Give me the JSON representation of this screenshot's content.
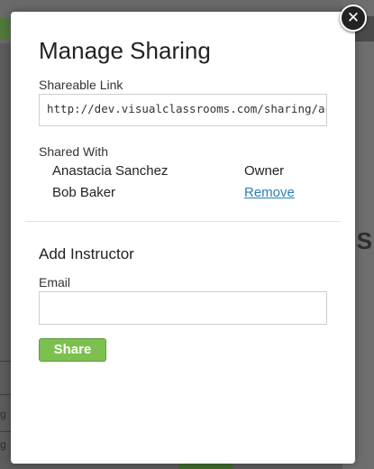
{
  "modal": {
    "title": "Manage Sharing",
    "close_icon": "close-icon",
    "shareable_link": {
      "label": "Shareable Link",
      "value": "http://dev.visualclassrooms.com/sharing/ac"
    },
    "shared_with": {
      "label": "Shared With",
      "people": [
        {
          "name": "Anastacia Sanchez",
          "role": "Owner"
        },
        {
          "name": "Bob Baker",
          "action": "Remove"
        }
      ]
    },
    "add_instructor": {
      "title": "Add Instructor",
      "email_label": "Email",
      "email_value": "",
      "share_button": "Share"
    }
  },
  "background": {
    "right_letter": "S",
    "left_fragment_1": "g",
    "left_fragment_2": "g"
  },
  "colors": {
    "share_button": "#7cc04f",
    "link": "#2a7fb8",
    "overlay": "#5c5c5c"
  }
}
